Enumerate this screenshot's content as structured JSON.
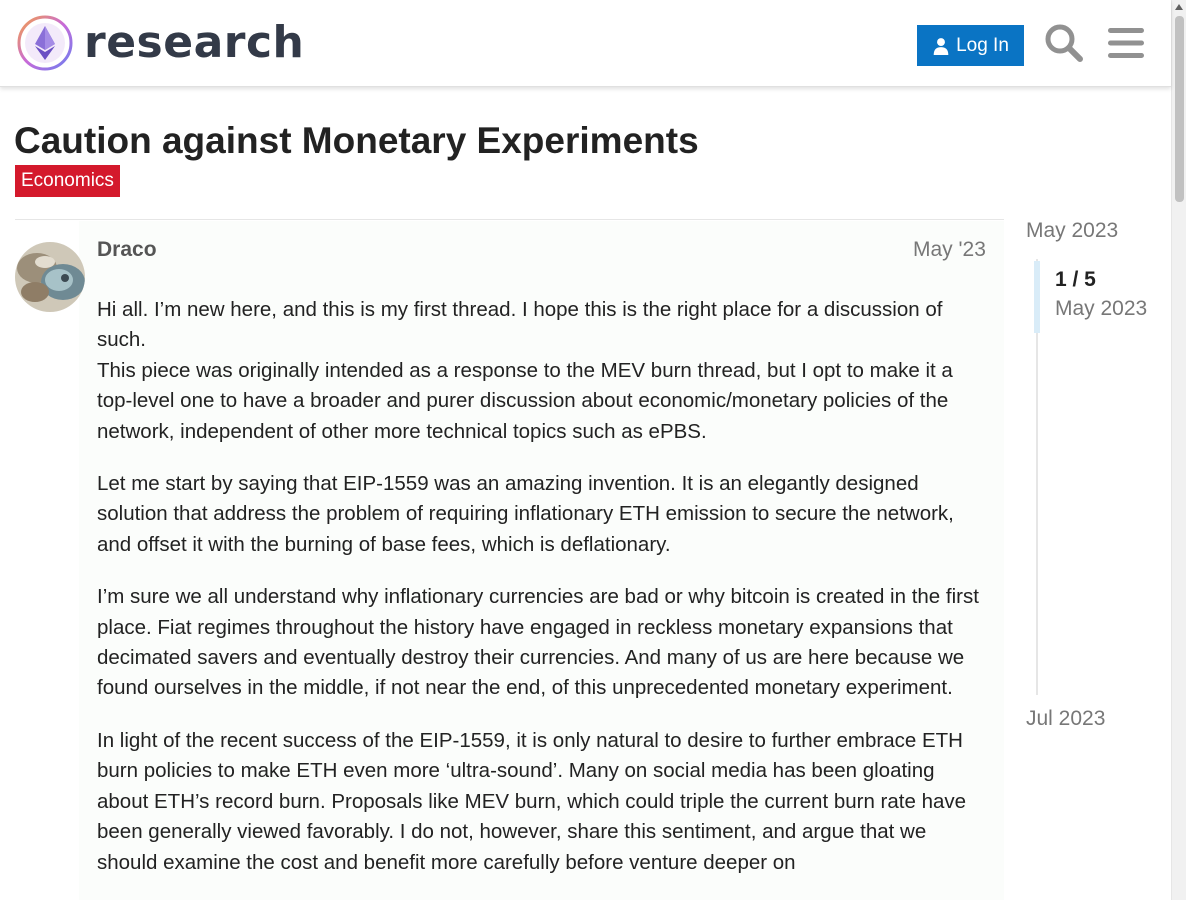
{
  "header": {
    "logo_text": "research",
    "login_label": "Log In",
    "icons": {
      "login": "user-icon",
      "search": "search-icon",
      "menu": "hamburger-menu-icon"
    }
  },
  "topic": {
    "title": "Caution against Monetary Experiments",
    "category": "Economics",
    "category_color": "#d4192c"
  },
  "post": {
    "author": "Draco",
    "date": "May '23",
    "paragraphs": [
      "Hi all. I’m new here, and this is my first thread. I hope this is the right place for a discussion of such.",
      "This piece was originally intended as a response to the MEV burn thread, but I opt to make it a top-level one to have a broader and purer discussion about economic/monetary policies of the network, independent of other more technical topics such as ePBS.",
      "Let me start by saying that EIP-1559 was an amazing invention. It is an elegantly designed solution that address the problem of requiring inflationary ETH emission to secure the network, and offset it with the burning of base fees, which is deflationary.",
      "I’m sure we all understand why inflationary currencies are bad or why bitcoin is created in the first place. Fiat regimes throughout the history have engaged in reckless monetary expansions that decimated savers and eventually destroy their currencies. And many of us are here because we found ourselves in the middle, if not near the end, of this unprecedented monetary experiment.",
      "In light of the recent success of the EIP-1559, it is only natural to desire to further embrace ETH burn policies to make ETH even more ‘ultra-sound’. Many on social media has been gloating about ETH’s record burn. Proposals like MEV burn, which could triple the current burn rate have been generally viewed favorably. I do not, however, share this sentiment, and argue that we should examine the cost and benefit more carefully before venture deeper on"
    ]
  },
  "timeline": {
    "start_date": "May 2023",
    "counter": "1 / 5",
    "current_date": "May 2023",
    "end_date": "Jul 2023"
  },
  "colors": {
    "accent": "#0a74c4",
    "category": "#d4192c",
    "post_bg": "#fbfdfb"
  }
}
